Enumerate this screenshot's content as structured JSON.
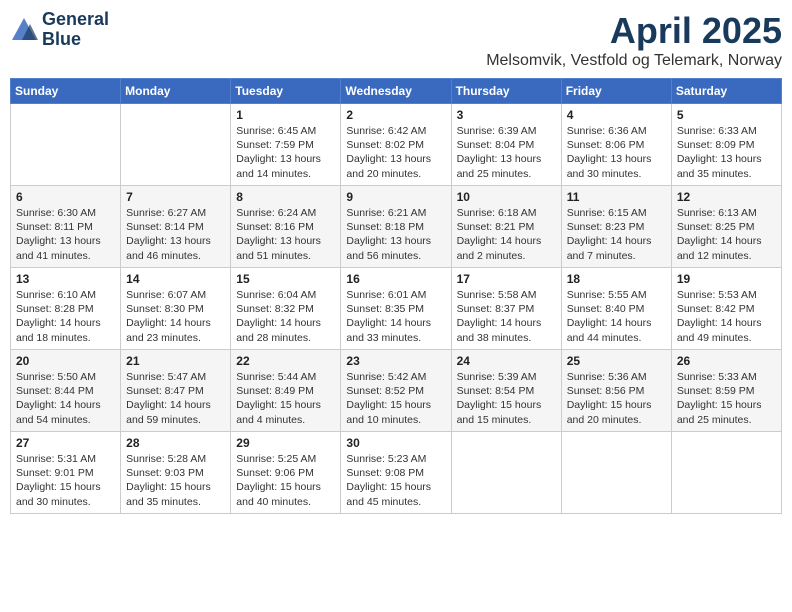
{
  "header": {
    "logo_line1": "General",
    "logo_line2": "Blue",
    "month": "April 2025",
    "location": "Melsomvik, Vestfold og Telemark, Norway"
  },
  "weekdays": [
    "Sunday",
    "Monday",
    "Tuesday",
    "Wednesday",
    "Thursday",
    "Friday",
    "Saturday"
  ],
  "weeks": [
    [
      {
        "day": "",
        "info": ""
      },
      {
        "day": "",
        "info": ""
      },
      {
        "day": "1",
        "info": "Sunrise: 6:45 AM\nSunset: 7:59 PM\nDaylight: 13 hours\nand 14 minutes."
      },
      {
        "day": "2",
        "info": "Sunrise: 6:42 AM\nSunset: 8:02 PM\nDaylight: 13 hours\nand 20 minutes."
      },
      {
        "day": "3",
        "info": "Sunrise: 6:39 AM\nSunset: 8:04 PM\nDaylight: 13 hours\nand 25 minutes."
      },
      {
        "day": "4",
        "info": "Sunrise: 6:36 AM\nSunset: 8:06 PM\nDaylight: 13 hours\nand 30 minutes."
      },
      {
        "day": "5",
        "info": "Sunrise: 6:33 AM\nSunset: 8:09 PM\nDaylight: 13 hours\nand 35 minutes."
      }
    ],
    [
      {
        "day": "6",
        "info": "Sunrise: 6:30 AM\nSunset: 8:11 PM\nDaylight: 13 hours\nand 41 minutes."
      },
      {
        "day": "7",
        "info": "Sunrise: 6:27 AM\nSunset: 8:14 PM\nDaylight: 13 hours\nand 46 minutes."
      },
      {
        "day": "8",
        "info": "Sunrise: 6:24 AM\nSunset: 8:16 PM\nDaylight: 13 hours\nand 51 minutes."
      },
      {
        "day": "9",
        "info": "Sunrise: 6:21 AM\nSunset: 8:18 PM\nDaylight: 13 hours\nand 56 minutes."
      },
      {
        "day": "10",
        "info": "Sunrise: 6:18 AM\nSunset: 8:21 PM\nDaylight: 14 hours\nand 2 minutes."
      },
      {
        "day": "11",
        "info": "Sunrise: 6:15 AM\nSunset: 8:23 PM\nDaylight: 14 hours\nand 7 minutes."
      },
      {
        "day": "12",
        "info": "Sunrise: 6:13 AM\nSunset: 8:25 PM\nDaylight: 14 hours\nand 12 minutes."
      }
    ],
    [
      {
        "day": "13",
        "info": "Sunrise: 6:10 AM\nSunset: 8:28 PM\nDaylight: 14 hours\nand 18 minutes."
      },
      {
        "day": "14",
        "info": "Sunrise: 6:07 AM\nSunset: 8:30 PM\nDaylight: 14 hours\nand 23 minutes."
      },
      {
        "day": "15",
        "info": "Sunrise: 6:04 AM\nSunset: 8:32 PM\nDaylight: 14 hours\nand 28 minutes."
      },
      {
        "day": "16",
        "info": "Sunrise: 6:01 AM\nSunset: 8:35 PM\nDaylight: 14 hours\nand 33 minutes."
      },
      {
        "day": "17",
        "info": "Sunrise: 5:58 AM\nSunset: 8:37 PM\nDaylight: 14 hours\nand 38 minutes."
      },
      {
        "day": "18",
        "info": "Sunrise: 5:55 AM\nSunset: 8:40 PM\nDaylight: 14 hours\nand 44 minutes."
      },
      {
        "day": "19",
        "info": "Sunrise: 5:53 AM\nSunset: 8:42 PM\nDaylight: 14 hours\nand 49 minutes."
      }
    ],
    [
      {
        "day": "20",
        "info": "Sunrise: 5:50 AM\nSunset: 8:44 PM\nDaylight: 14 hours\nand 54 minutes."
      },
      {
        "day": "21",
        "info": "Sunrise: 5:47 AM\nSunset: 8:47 PM\nDaylight: 14 hours\nand 59 minutes."
      },
      {
        "day": "22",
        "info": "Sunrise: 5:44 AM\nSunset: 8:49 PM\nDaylight: 15 hours\nand 4 minutes."
      },
      {
        "day": "23",
        "info": "Sunrise: 5:42 AM\nSunset: 8:52 PM\nDaylight: 15 hours\nand 10 minutes."
      },
      {
        "day": "24",
        "info": "Sunrise: 5:39 AM\nSunset: 8:54 PM\nDaylight: 15 hours\nand 15 minutes."
      },
      {
        "day": "25",
        "info": "Sunrise: 5:36 AM\nSunset: 8:56 PM\nDaylight: 15 hours\nand 20 minutes."
      },
      {
        "day": "26",
        "info": "Sunrise: 5:33 AM\nSunset: 8:59 PM\nDaylight: 15 hours\nand 25 minutes."
      }
    ],
    [
      {
        "day": "27",
        "info": "Sunrise: 5:31 AM\nSunset: 9:01 PM\nDaylight: 15 hours\nand 30 minutes."
      },
      {
        "day": "28",
        "info": "Sunrise: 5:28 AM\nSunset: 9:03 PM\nDaylight: 15 hours\nand 35 minutes."
      },
      {
        "day": "29",
        "info": "Sunrise: 5:25 AM\nSunset: 9:06 PM\nDaylight: 15 hours\nand 40 minutes."
      },
      {
        "day": "30",
        "info": "Sunrise: 5:23 AM\nSunset: 9:08 PM\nDaylight: 15 hours\nand 45 minutes."
      },
      {
        "day": "",
        "info": ""
      },
      {
        "day": "",
        "info": ""
      },
      {
        "day": "",
        "info": ""
      }
    ]
  ]
}
